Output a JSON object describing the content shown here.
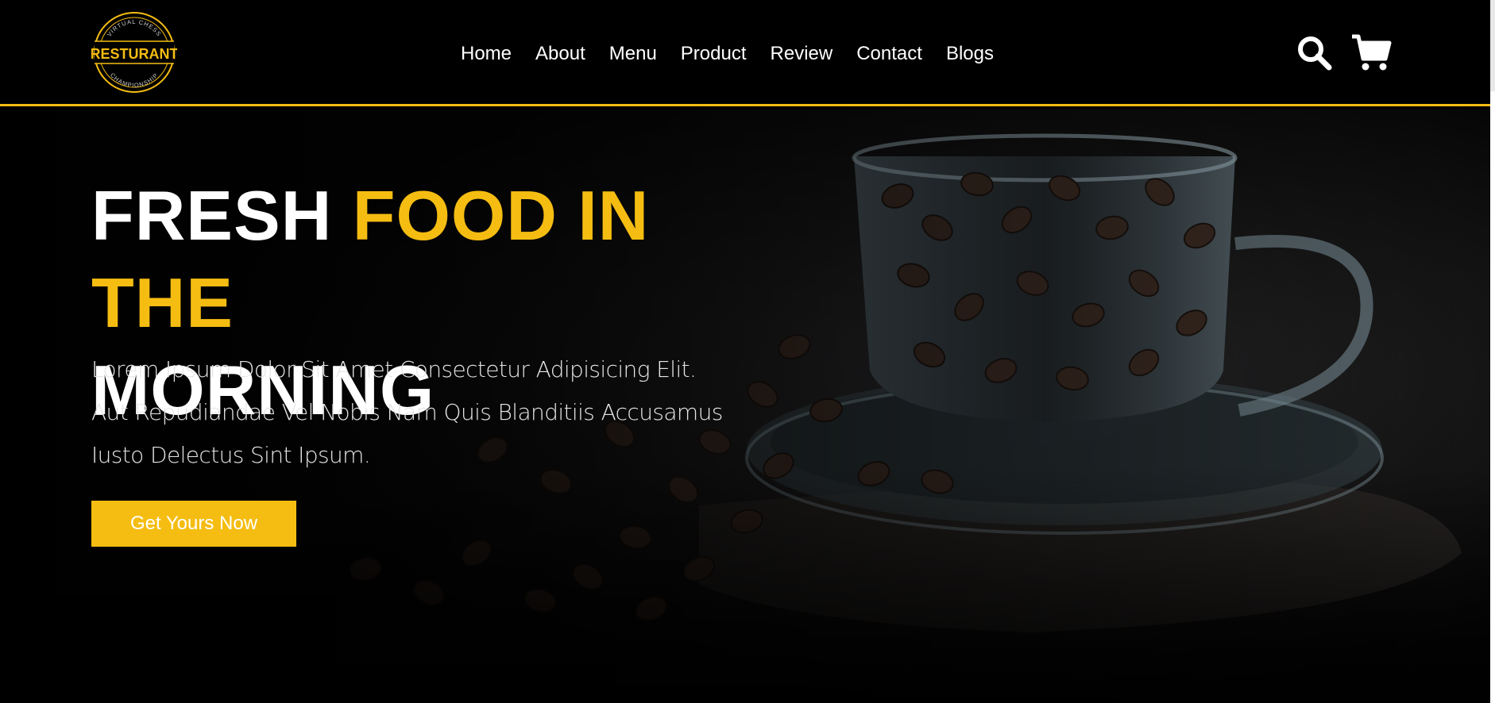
{
  "brand": {
    "logo_text": "RESTURANT",
    "logo_arc_top": "VIRTUAL CHESS",
    "logo_arc_bottom": "CHAMPIONSHIP",
    "accent_color": "#f5bd12"
  },
  "nav": {
    "items": [
      {
        "label": "Home"
      },
      {
        "label": "About"
      },
      {
        "label": "Menu"
      },
      {
        "label": "Product"
      },
      {
        "label": "Review"
      },
      {
        "label": "Contact"
      },
      {
        "label": "Blogs"
      }
    ]
  },
  "header_icons": {
    "search": "search-icon",
    "cart": "cart-icon"
  },
  "hero": {
    "title_part1": "FRESH ",
    "title_accent": "FOOD IN THE",
    "title_part2": "MORNING",
    "description": "Lorem Ipsum Dolor Sit Amet Consectetur Adipisicing Elit. Aut Repudiandae Vel Nobis Nam Quis Blanditiis Accusamus Iusto Delectus Sint Ipsum.",
    "cta_label": "Get Yours Now",
    "background": "coffee-beans-in-glass-cup"
  }
}
